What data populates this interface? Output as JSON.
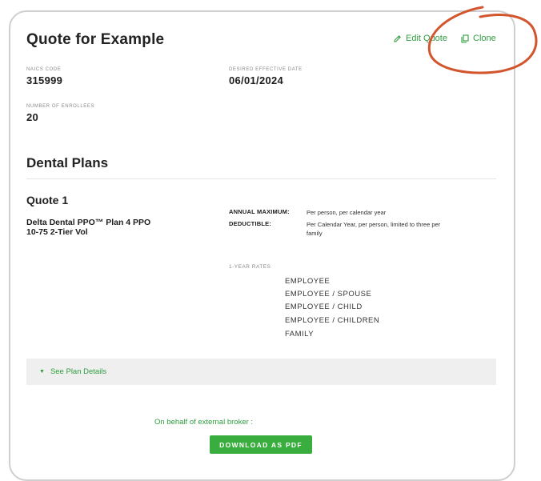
{
  "header": {
    "title": "Quote for Example",
    "edit_label": "Edit Quote",
    "clone_label": "Clone"
  },
  "fields": {
    "naics_label": "NAICS CODE",
    "naics_value": "315999",
    "effective_label": "DESIRED EFFECTIVE DATE",
    "effective_value": "06/01/2024",
    "enrollees_label": "NUMBER OF ENROLLEES",
    "enrollees_value": "20"
  },
  "section": {
    "title": "Dental Plans"
  },
  "quote": {
    "title": "Quote 1",
    "plan_line1": "Delta Dental PPO™ Plan 4 PPO",
    "plan_line2": "10-75 2-Tier Vol",
    "annual_max_label": "ANNUAL MAXIMUM:",
    "annual_max_value": "Per person, per calendar year",
    "deductible_label": "DEDUCTIBLE:",
    "deductible_value": "Per Calendar Year, per person, limited to three per family",
    "rates_label": "1-YEAR RATES",
    "tiers": [
      "EMPLOYEE",
      "EMPLOYEE / SPOUSE",
      "EMPLOYEE / CHILD",
      "EMPLOYEE / CHILDREN",
      "FAMILY"
    ]
  },
  "details": {
    "label": "See Plan Details"
  },
  "footer": {
    "broker_text": "On behalf of external broker :",
    "download_label": "DOWNLOAD AS PDF"
  },
  "colors": {
    "accent": "#3aad3f",
    "link": "#2e9e3e",
    "annotation_circle": "#d2552e"
  },
  "icons": {
    "edit": "pencil-icon",
    "clone": "copy-icon",
    "details": "caret-down-icon"
  }
}
